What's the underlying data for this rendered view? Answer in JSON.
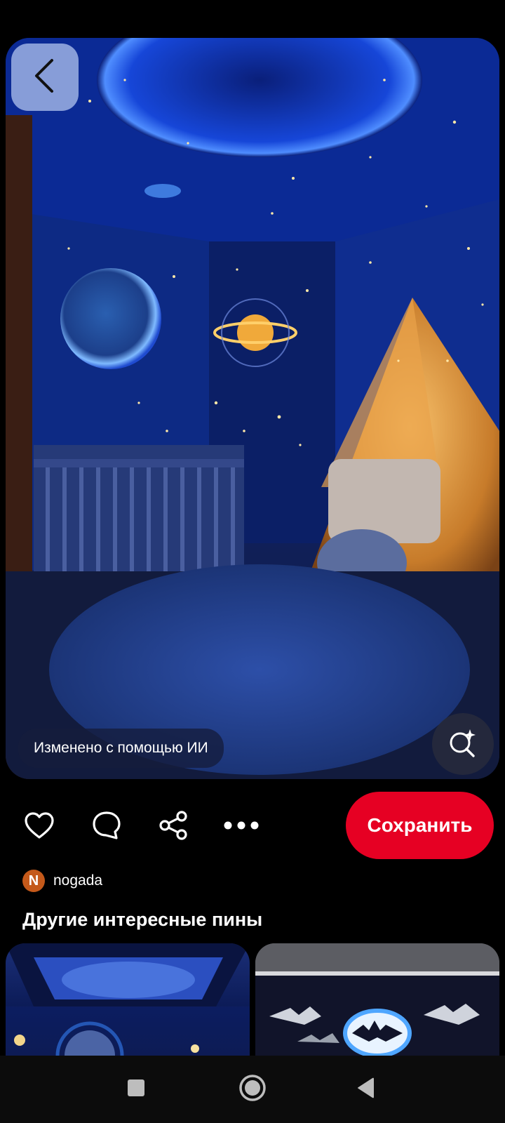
{
  "pin": {
    "ai_label": "Изменено с помощью ИИ",
    "back_icon": "chevron-left-icon",
    "visual_search_icon": "lens-sparkle-icon"
  },
  "actions": {
    "like_icon": "heart-icon",
    "comment_icon": "comment-icon",
    "share_icon": "share-icon",
    "more_icon": "more-icon",
    "save_label": "Сохранить",
    "save_color": "#e60023"
  },
  "author": {
    "initial": "N",
    "name": "nogada",
    "avatar_color": "#c4591a"
  },
  "related": {
    "title": "Другие интересные пины"
  },
  "navbar": {
    "recents_icon": "square-icon",
    "home_icon": "circle-icon",
    "back_icon": "triangle-back-icon"
  }
}
